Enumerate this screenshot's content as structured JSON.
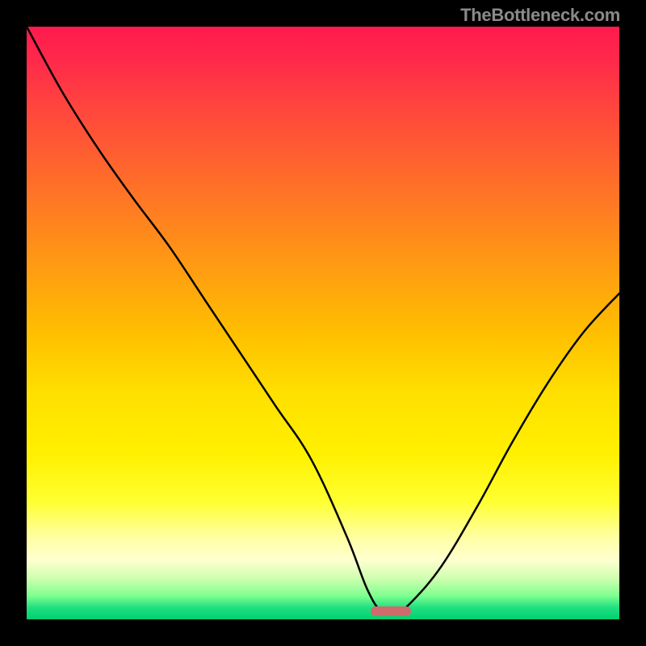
{
  "watermark": {
    "text": "TheBottleneck.com"
  },
  "chart_data": {
    "type": "line",
    "title": "",
    "xlabel": "",
    "ylabel": "",
    "xlim": [
      0,
      100
    ],
    "ylim": [
      0,
      100
    ],
    "grid": false,
    "series": [
      {
        "name": "bottleneck-curve",
        "x": [
          0,
          6,
          12,
          18,
          24,
          30,
          36,
          42,
          48,
          54,
          57.5,
          60,
          62.5,
          65,
          70,
          76,
          82,
          88,
          94,
          100
        ],
        "y": [
          100,
          89,
          79.5,
          71,
          63,
          54,
          45,
          36,
          27,
          14,
          5,
          1.2,
          1.2,
          3,
          9,
          19,
          30,
          40,
          48.5,
          55
        ]
      }
    ],
    "marker": {
      "x_center": 61.5,
      "y": 1.3,
      "width_pct": 6.8,
      "color": "#d16a6a"
    },
    "background_gradient": [
      "#ff1a4d",
      "#ff4040",
      "#ff8020",
      "#ffc000",
      "#ffff30",
      "#ffffd0",
      "#20e080",
      "#00d070"
    ]
  }
}
